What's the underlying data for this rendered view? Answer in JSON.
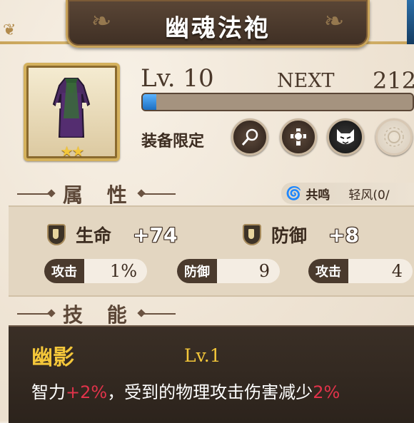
{
  "title": "幽魂法袍",
  "item": {
    "icon": "robe-icon",
    "stars": "★★",
    "level": "Lv. 10",
    "next_label": "NEXT",
    "next_value": "212",
    "exp_progress_fraction": 0.05
  },
  "equip_restriction": {
    "label": "装备限定",
    "classes": [
      {
        "name": "staff-class-icon",
        "glyph": "⚲"
      },
      {
        "name": "cross-class-icon",
        "glyph": "✚"
      },
      {
        "name": "cat-class-icon",
        "glyph": "🐱"
      },
      {
        "name": "sun-class-icon",
        "glyph": "✺"
      }
    ]
  },
  "attributes": {
    "header": "属 性",
    "resonance": {
      "label": "共鸣",
      "value": "轻风(0/"
    },
    "main": [
      {
        "label": "生命",
        "value": "+74"
      },
      {
        "label": "防御",
        "value": "+8"
      }
    ],
    "sub": [
      {
        "label": "攻击",
        "value": "1%"
      },
      {
        "label": "防御",
        "value": "9"
      },
      {
        "label": "攻击",
        "value": "4"
      }
    ]
  },
  "skills": {
    "header": "技 能",
    "name": "幽影",
    "level": "Lv.1",
    "desc_part1": "智力",
    "desc_value1": "+2%",
    "desc_part2": "，受到的物理攻击伤害减少",
    "desc_value2": "2%"
  },
  "colors": {
    "accent_gold": "#f4c73a",
    "highlight_red": "#e0334a",
    "progress_blue": "#1c6fc2"
  }
}
